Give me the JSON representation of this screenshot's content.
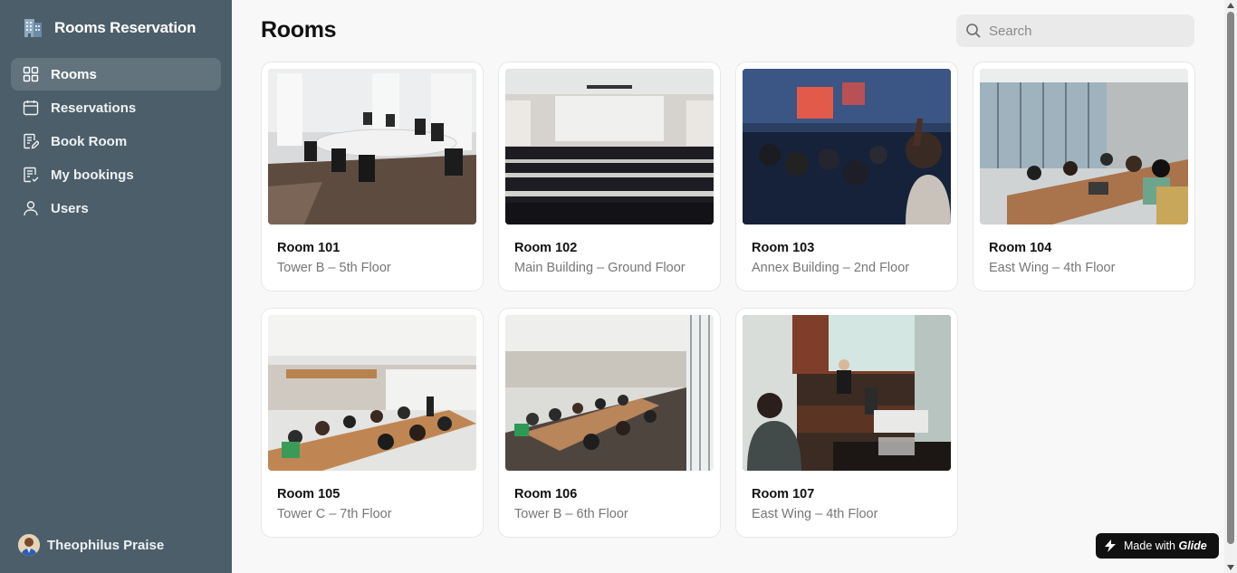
{
  "app": {
    "title": "Rooms Reservation",
    "logo_icon": "building-icon"
  },
  "sidebar": {
    "items": [
      {
        "label": "Rooms",
        "icon": "grid-icon",
        "active": true
      },
      {
        "label": "Reservations",
        "icon": "calendar-icon",
        "active": false
      },
      {
        "label": "Book Room",
        "icon": "edit-document-icon",
        "active": false
      },
      {
        "label": "My bookings",
        "icon": "list-document-icon",
        "active": false
      },
      {
        "label": "Users",
        "icon": "user-icon",
        "active": false
      }
    ],
    "user": {
      "name": "Theophilus Praise"
    }
  },
  "page": {
    "title": "Rooms"
  },
  "search": {
    "placeholder": "Search",
    "value": ""
  },
  "rooms": [
    {
      "name": "Room 101",
      "location": "Tower B – 5th Floor"
    },
    {
      "name": "Room 102",
      "location": "Main Building – Ground Floor"
    },
    {
      "name": "Room 103",
      "location": "Annex Building – 2nd Floor"
    },
    {
      "name": "Room 104",
      "location": "East Wing – 4th Floor"
    },
    {
      "name": "Room 105",
      "location": "Tower C – 7th Floor"
    },
    {
      "name": "Room 106",
      "location": "Tower B – 6th Floor"
    },
    {
      "name": "Room 107",
      "location": "East Wing – 4th Floor"
    }
  ],
  "badge": {
    "prefix": "Made with",
    "brand": "Glide"
  },
  "colors": {
    "sidebar": "#4c5e69",
    "sidebar_active": "#63737e",
    "background": "#f8f8f8"
  }
}
